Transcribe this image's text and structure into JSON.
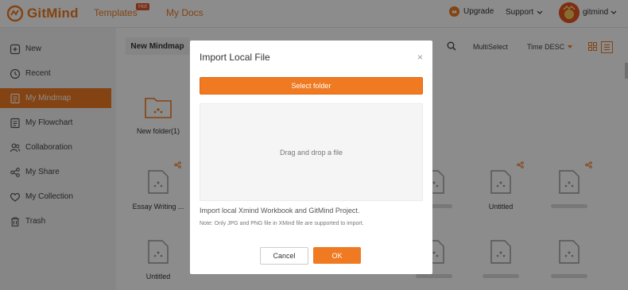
{
  "header": {
    "logo_text": "GitMind",
    "nav_templates": "Templates",
    "hot_badge": "Hot",
    "nav_mydocs": "My Docs",
    "upgrade": "Upgrade",
    "support": "Support",
    "username": "gitmind"
  },
  "sidebar": {
    "items": [
      {
        "label": "New",
        "icon": "plus-square-icon"
      },
      {
        "label": "Recent",
        "icon": "clock-icon"
      },
      {
        "label": "My Mindmap",
        "icon": "document-icon",
        "active": true
      },
      {
        "label": "My Flowchart",
        "icon": "flowchart-icon"
      },
      {
        "label": "Collaboration",
        "icon": "users-icon"
      },
      {
        "label": "My Share",
        "icon": "share-icon"
      },
      {
        "label": "My Collection",
        "icon": "heart-icon"
      },
      {
        "label": "Trash",
        "icon": "trash-icon"
      }
    ]
  },
  "toolbar": {
    "new_mindmap": "New Mindmap",
    "multiselect": "MultiSelect",
    "sort": "Time DESC"
  },
  "files": {
    "folder_name": "New folder(1)",
    "row1_left_name": "Essay Writing ...",
    "row1_right_name": "Untitled",
    "row2_left_name": "Untitled"
  },
  "modal": {
    "title": "Import Local File",
    "close": "×",
    "select_folder": "Select folder",
    "dropzone": "Drag and drop a file",
    "description": "Import local Xmind Workbook and GitMind Project.",
    "note": "Note: Only JPG and PNG file in XMind file are supported to import.",
    "cancel": "Cancel",
    "ok": "OK"
  },
  "colors": {
    "accent": "#f07a21",
    "hot": "#e8542b"
  }
}
